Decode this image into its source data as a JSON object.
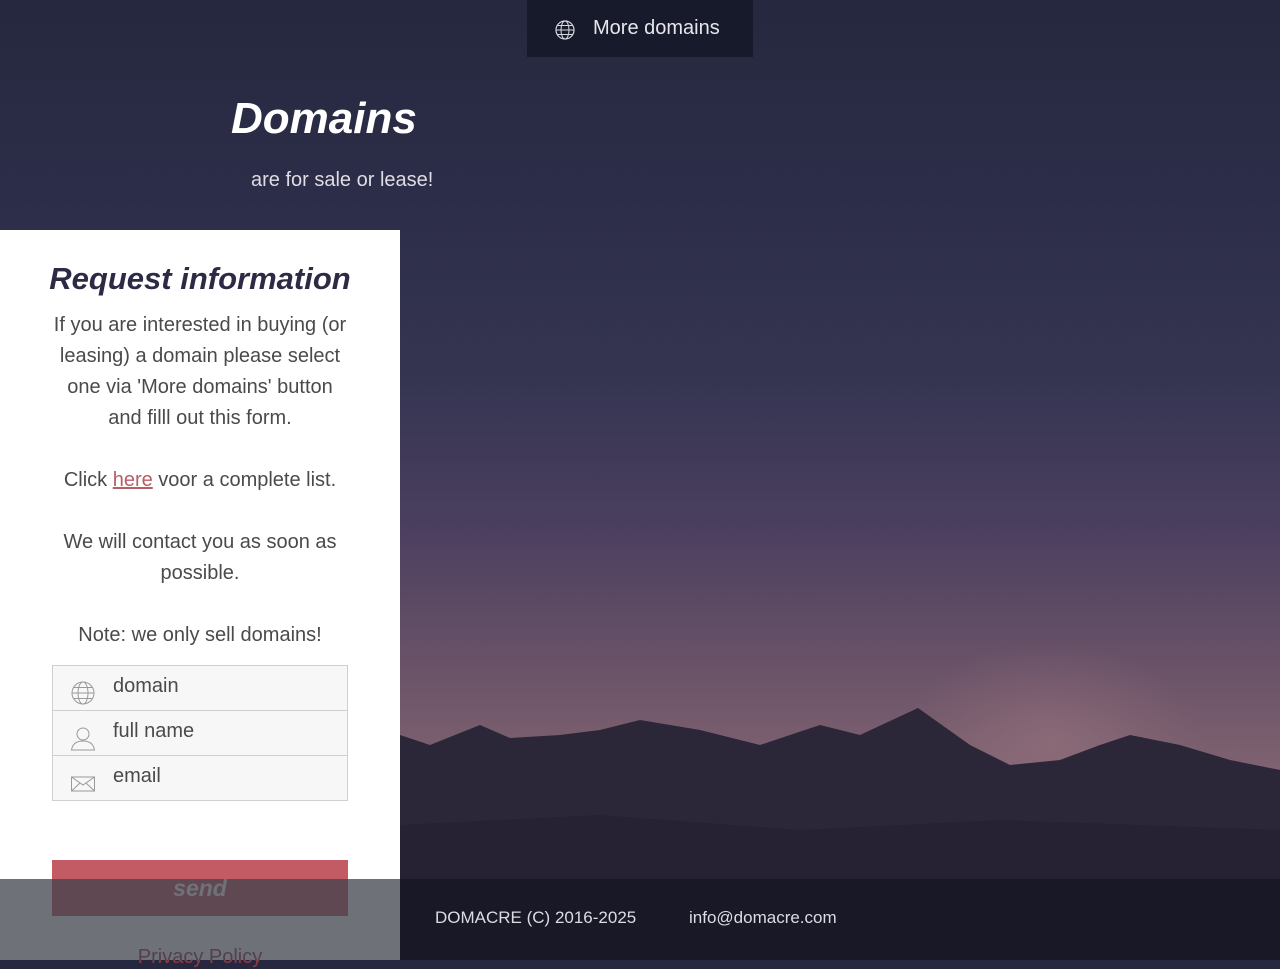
{
  "top_button": {
    "label": "More domains",
    "icon": "globe-icon"
  },
  "hero": {
    "title": "Domains",
    "subtitle": "are for sale or lease!"
  },
  "form_panel": {
    "title": "Request information",
    "intro": "If you are interested in buying (or leasing) a domain please select one via 'More domains' button and filll out this form.",
    "click_prefix": "Click ",
    "click_link": "here",
    "click_suffix": " voor a complete list.",
    "contact_text": "We will contact you as soon as possible.",
    "note_text": "Note: we only sell domains!",
    "fields": [
      {
        "placeholder": "domain",
        "value": "",
        "icon": "globe-icon"
      },
      {
        "placeholder": "full name",
        "value": "",
        "icon": "user-icon"
      },
      {
        "placeholder": "email",
        "value": "",
        "icon": "envelope-icon"
      }
    ],
    "send_label": "send",
    "privacy_label": "Privacy Policy"
  },
  "footer": {
    "copyright": "DOMACRE (C) 2016-2025",
    "email": "info@domacre.com"
  },
  "colors": {
    "accent": "#c25b63",
    "link": "#b75e66",
    "title": "#2c2a45",
    "topbar": "#171a2b"
  }
}
